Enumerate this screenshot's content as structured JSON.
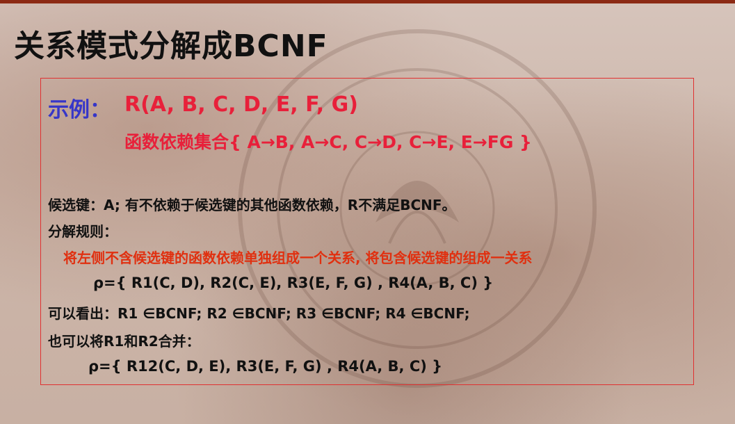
{
  "title": "关系模式分解成BCNF",
  "example": {
    "label": "示例：",
    "relation": "R(A, B, C, D, E, F, G)",
    "fd_set": "函数依赖集合{ A→B, A→C, C→D,  C→E,  E→FG }"
  },
  "candidate_key_line": "候选键：A;   有不依赖于候选键的其他函数依赖，R不满足BCNF。",
  "rule_heading": "分解规则：",
  "rule_text": "将左侧不含候选键的函数依赖单独组成一个关系, 将包含候选键的组成一关系",
  "decomposition_1": "ρ={ R1(C, D),   R2(C, E), R3(E, F, G) , R4(A, B, C) }",
  "observation": "可以看出：R1 ∈BCNF;   R2 ∈BCNF;   R3 ∈BCNF;   R4 ∈BCNF;",
  "merge_line": "也可以将R1和R2合并：",
  "decomposition_2": "ρ={ R12(C, D, E), R3(E, F, G) , R4(A, B, C) }",
  "colors": {
    "accent_red": "#e8203a",
    "label_blue": "#3636c8",
    "rule_red": "#e03010",
    "border_red": "#e03030",
    "top_bar": "#8c2a14"
  }
}
